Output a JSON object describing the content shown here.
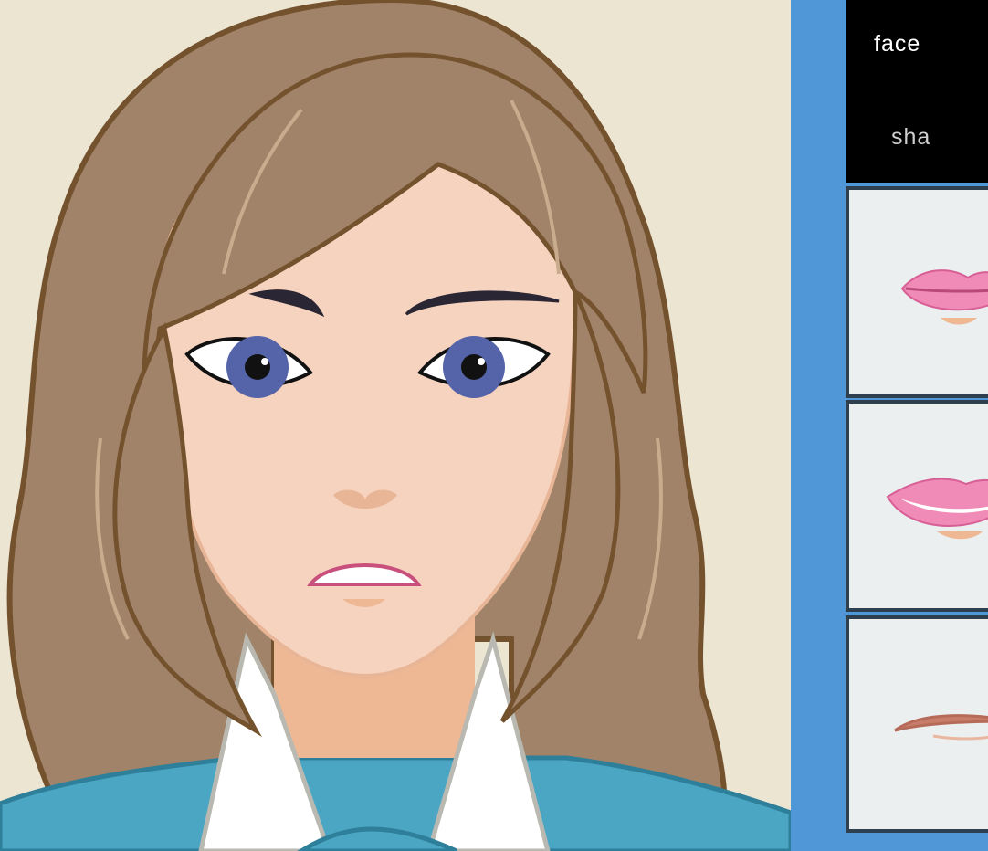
{
  "panel": {
    "title": "face",
    "subtitle": "sha"
  },
  "options": [
    {
      "icon": "pink-lips-closed-icon"
    },
    {
      "icon": "pink-lips-smile-icon"
    },
    {
      "icon": "thin-lips-icon"
    }
  ],
  "colors": {
    "background": "#ebe5d2",
    "panel": "#4f97d6",
    "header": "#000000",
    "option_bg": "#eceff0",
    "option_border": "#2e3f50",
    "hair": "#a08368",
    "skin": "#f6d3bf",
    "eyes": "#5563a8",
    "shirt": "#4aa6c3",
    "lips": "#e07aa5"
  }
}
